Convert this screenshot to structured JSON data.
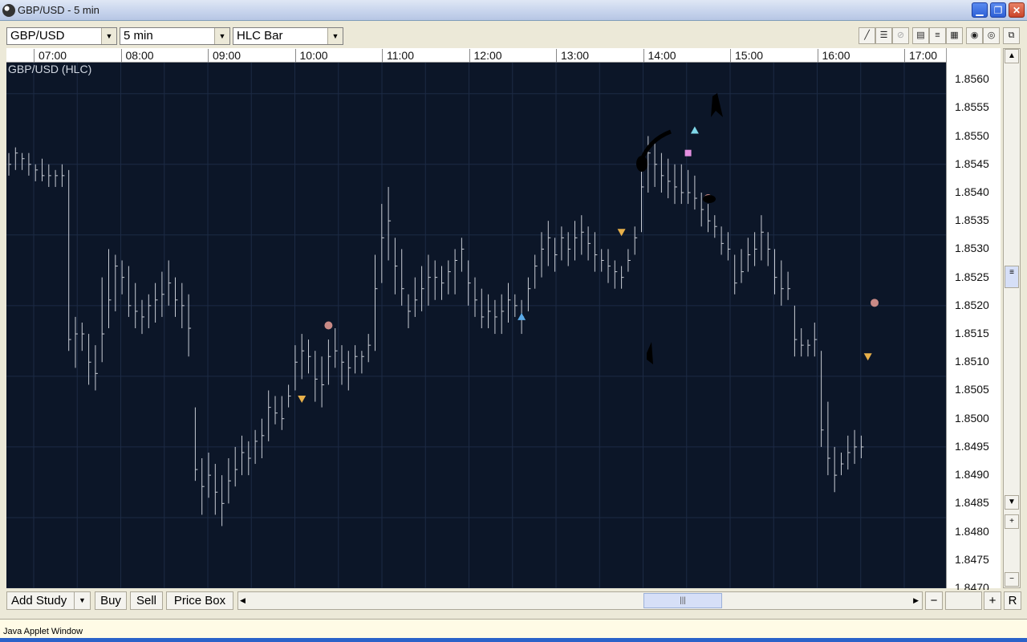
{
  "window": {
    "title": "GBP/USD - 5 min"
  },
  "toolbar": {
    "symbol": "GBP/USD",
    "interval": "5 min",
    "chart_type": "HLC Bar"
  },
  "chart": {
    "caption": "GBP/USD (HLC)",
    "time_labels": [
      "07:00",
      "08:00",
      "09:00",
      "10:00",
      "11:00",
      "12:00",
      "13:00",
      "14:00",
      "15:00",
      "16:00",
      "17:00"
    ],
    "price_labels": [
      "1.8560",
      "1.8555",
      "1.8550",
      "1.8545",
      "1.8540",
      "1.8535",
      "1.8530",
      "1.8525",
      "1.8520",
      "1.8515",
      "1.8510",
      "1.8505",
      "1.8500",
      "1.8495",
      "1.8490",
      "1.8485",
      "1.8480",
      "1.8475",
      "1.8470"
    ],
    "colors": {
      "background": "#0c1628",
      "grid": "#1c2a44",
      "bars": "#c8ccd4"
    }
  },
  "chart_data": {
    "type": "bar",
    "bar_style": "HLC",
    "series": [
      {
        "name": "GBP/USD",
        "bars_hlc": [
          [
            1.8547,
            1.8543,
            1.8545
          ],
          [
            1.8548,
            1.8544,
            1.8547
          ],
          [
            1.8547,
            1.8544,
            1.8546
          ],
          [
            1.8547,
            1.8543,
            1.8545
          ],
          [
            1.8545,
            1.8542,
            1.8544
          ],
          [
            1.8546,
            1.8542,
            1.8543
          ],
          [
            1.8545,
            1.8541,
            1.8543
          ],
          [
            1.8544,
            1.8541,
            1.8543
          ],
          [
            1.8545,
            1.8541,
            1.8543
          ],
          [
            1.8544,
            1.8512,
            1.8514
          ],
          [
            1.8518,
            1.8509,
            1.8515
          ],
          [
            1.8517,
            1.8512,
            1.8515
          ],
          [
            1.8515,
            1.8506,
            1.851
          ],
          [
            1.8513,
            1.8505,
            1.8508
          ],
          [
            1.8525,
            1.851,
            1.8515
          ],
          [
            1.853,
            1.8516,
            1.8521
          ],
          [
            1.8529,
            1.8519,
            1.8527
          ],
          [
            1.8528,
            1.8522,
            1.8525
          ],
          [
            1.8527,
            1.8518,
            1.852
          ],
          [
            1.8524,
            1.8516,
            1.8519
          ],
          [
            1.8521,
            1.8515,
            1.8518
          ],
          [
            1.8522,
            1.8516,
            1.852
          ],
          [
            1.8524,
            1.8517,
            1.8521
          ],
          [
            1.8526,
            1.8518,
            1.8522
          ],
          [
            1.8528,
            1.852,
            1.8524
          ],
          [
            1.8525,
            1.8518,
            1.8521
          ],
          [
            1.8524,
            1.8516,
            1.852
          ],
          [
            1.8522,
            1.8511,
            1.8516
          ],
          [
            1.8502,
            1.8489,
            1.8491
          ],
          [
            1.8493,
            1.8483,
            1.8488
          ],
          [
            1.8494,
            1.8486,
            1.849
          ],
          [
            1.8492,
            1.8483,
            1.8487
          ],
          [
            1.849,
            1.8481,
            1.8485
          ],
          [
            1.8493,
            1.8485,
            1.8489
          ],
          [
            1.8495,
            1.8488,
            1.8491
          ],
          [
            1.8497,
            1.849,
            1.8494
          ],
          [
            1.8496,
            1.849,
            1.8493
          ],
          [
            1.8498,
            1.8492,
            1.8496
          ],
          [
            1.85,
            1.8493,
            1.8497
          ],
          [
            1.8505,
            1.8496,
            1.8502
          ],
          [
            1.8504,
            1.8499,
            1.8501
          ],
          [
            1.8504,
            1.8498,
            1.85
          ],
          [
            1.8506,
            1.8502,
            1.8504
          ],
          [
            1.8513,
            1.8505,
            1.851
          ],
          [
            1.8515,
            1.8507,
            1.8512
          ],
          [
            1.8514,
            1.8508,
            1.8511
          ],
          [
            1.8512,
            1.8503,
            1.8507
          ],
          [
            1.8511,
            1.8502,
            1.8506
          ],
          [
            1.8514,
            1.8506,
            1.8511
          ],
          [
            1.8516,
            1.8509,
            1.8512
          ],
          [
            1.8513,
            1.8506,
            1.851
          ],
          [
            1.8512,
            1.8505,
            1.8509
          ],
          [
            1.8513,
            1.8508,
            1.8511
          ],
          [
            1.8512,
            1.8508,
            1.8511
          ],
          [
            1.8515,
            1.851,
            1.8513
          ],
          [
            1.8529,
            1.8512,
            1.8523
          ],
          [
            1.8538,
            1.8524,
            1.8532
          ],
          [
            1.8541,
            1.8528,
            1.8535
          ],
          [
            1.8532,
            1.8522,
            1.8527
          ],
          [
            1.853,
            1.852,
            1.8523
          ],
          [
            1.8522,
            1.8516,
            1.8519
          ],
          [
            1.8525,
            1.8518,
            1.8521
          ],
          [
            1.8527,
            1.8519,
            1.8523
          ],
          [
            1.8529,
            1.852,
            1.8525
          ],
          [
            1.8528,
            1.8521,
            1.8525
          ],
          [
            1.8527,
            1.8521,
            1.8524
          ],
          [
            1.8528,
            1.8522,
            1.8526
          ],
          [
            1.853,
            1.8522,
            1.8528
          ],
          [
            1.8532,
            1.8526,
            1.853
          ],
          [
            1.8528,
            1.852,
            1.8524
          ],
          [
            1.8525,
            1.8518,
            1.8521
          ],
          [
            1.8523,
            1.8516,
            1.8518
          ],
          [
            1.8522,
            1.8516,
            1.8519
          ],
          [
            1.8521,
            1.8515,
            1.8518
          ],
          [
            1.8522,
            1.8515,
            1.8519
          ],
          [
            1.8524,
            1.8517,
            1.8521
          ],
          [
            1.8522,
            1.8518,
            1.852
          ],
          [
            1.8521,
            1.8515,
            1.8518
          ],
          [
            1.8525,
            1.8519,
            1.8523
          ],
          [
            1.8529,
            1.8523,
            1.8527
          ],
          [
            1.8533,
            1.8525,
            1.853
          ],
          [
            1.8535,
            1.8527,
            1.8532
          ],
          [
            1.8532,
            1.8526,
            1.8529
          ],
          [
            1.8534,
            1.8528,
            1.8532
          ],
          [
            1.8533,
            1.8527,
            1.853
          ],
          [
            1.8535,
            1.8528,
            1.8532
          ],
          [
            1.8536,
            1.8529,
            1.8533
          ],
          [
            1.8534,
            1.8528,
            1.8531
          ],
          [
            1.8533,
            1.8526,
            1.8529
          ],
          [
            1.853,
            1.8526,
            1.8528
          ],
          [
            1.853,
            1.8524,
            1.8527
          ],
          [
            1.8528,
            1.8523,
            1.8526
          ],
          [
            1.8527,
            1.8523,
            1.8525
          ],
          [
            1.853,
            1.8526,
            1.8528
          ],
          [
            1.8534,
            1.8529,
            1.8532
          ],
          [
            1.8544,
            1.8533,
            1.8541
          ],
          [
            1.855,
            1.854,
            1.8547
          ],
          [
            1.8549,
            1.8541,
            1.8545
          ],
          [
            1.8547,
            1.854,
            1.8543
          ],
          [
            1.8546,
            1.8539,
            1.8542
          ],
          [
            1.8545,
            1.8538,
            1.8541
          ],
          [
            1.8545,
            1.8538,
            1.854
          ],
          [
            1.8544,
            1.8538,
            1.854
          ],
          [
            1.8543,
            1.8537,
            1.8539
          ],
          [
            1.854,
            1.8534,
            1.8537
          ],
          [
            1.8538,
            1.8533,
            1.8535
          ],
          [
            1.8536,
            1.8532,
            1.8534
          ],
          [
            1.8534,
            1.8529,
            1.8531
          ],
          [
            1.8533,
            1.8528,
            1.853
          ],
          [
            1.8529,
            1.8522,
            1.8524
          ],
          [
            1.853,
            1.8524,
            1.8526
          ],
          [
            1.8532,
            1.8526,
            1.8529
          ],
          [
            1.8533,
            1.8527,
            1.853
          ],
          [
            1.8536,
            1.8528,
            1.8533
          ],
          [
            1.8533,
            1.8527,
            1.853
          ],
          [
            1.853,
            1.8522,
            1.8525
          ],
          [
            1.8528,
            1.852,
            1.8523
          ],
          [
            1.8526,
            1.8521,
            1.8523
          ],
          [
            1.852,
            1.8511,
            1.8514
          ],
          [
            1.8516,
            1.8511,
            1.8513
          ],
          [
            1.8514,
            1.8511,
            1.8513
          ],
          [
            1.8517,
            1.8511,
            1.8514
          ],
          [
            1.8512,
            1.8495,
            1.8498
          ],
          [
            1.8503,
            1.849,
            1.8493
          ],
          [
            1.8495,
            1.8487,
            1.849
          ],
          [
            1.8494,
            1.849,
            1.8492
          ],
          [
            1.8497,
            1.8491,
            1.8494
          ],
          [
            1.8498,
            1.8492,
            1.8495
          ],
          [
            1.8497,
            1.8493,
            1.8495
          ]
        ]
      }
    ],
    "x_labels": [
      "07:00",
      "08:00",
      "09:00",
      "10:00",
      "11:00",
      "12:00",
      "13:00",
      "14:00",
      "15:00",
      "16:00",
      "17:00"
    ],
    "ylim": [
      1.847,
      1.8563
    ],
    "grid": true,
    "markers": [
      {
        "kind": "circle",
        "color": "#c98a86",
        "bar": 48,
        "price": 1.85165
      },
      {
        "kind": "triangle-down",
        "color": "#e8b04a",
        "bar": 44,
        "price": 1.85035
      },
      {
        "kind": "triangle-up",
        "color": "#5aa9e6",
        "bar": 77,
        "price": 1.8518
      },
      {
        "kind": "triangle-down",
        "color": "#e8b04a",
        "bar": 92,
        "price": 1.8533
      },
      {
        "kind": "square",
        "color": "#e48fe0",
        "bar": 102,
        "price": 1.8547
      },
      {
        "kind": "triangle-up",
        "color": "#7fd7e8",
        "bar": 103,
        "price": 1.8551
      },
      {
        "kind": "circle",
        "color": "#c98a86",
        "bar": 105,
        "price": 1.8539
      },
      {
        "kind": "circle",
        "color": "#c98a86",
        "bar": 130,
        "price": 1.85205
      },
      {
        "kind": "triangle-down",
        "color": "#e8b04a",
        "bar": 129,
        "price": 1.8511
      }
    ]
  },
  "bottom": {
    "add_study": "Add Study",
    "buy": "Buy",
    "sell": "Sell",
    "price_box": "Price Box",
    "minus": "−",
    "plus": "+",
    "reset": "R"
  },
  "status": {
    "text": "Java Applet Window"
  }
}
